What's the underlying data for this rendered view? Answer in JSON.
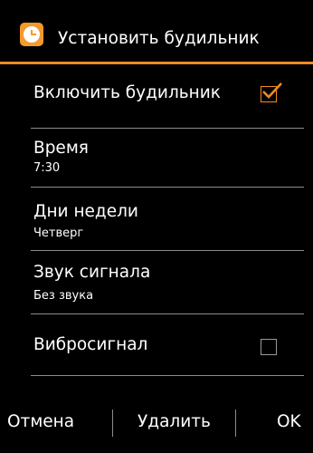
{
  "header": {
    "title": "Установить будильник",
    "icon": "alarm-clock-icon",
    "accent_color": "#f08a24"
  },
  "rows": {
    "enable_alarm": {
      "label": "Включить будильник",
      "checked": true
    },
    "time": {
      "label": "Время",
      "value": "7:30"
    },
    "days": {
      "label": "Дни недели",
      "value": "Четверг"
    },
    "sound": {
      "label": "Звук сигнала",
      "value": "Без звука"
    },
    "vibration": {
      "label": "Вибросигнал",
      "checked": false
    }
  },
  "softkeys": {
    "left": "Отмена",
    "center": "Удалить",
    "right": "OK"
  }
}
